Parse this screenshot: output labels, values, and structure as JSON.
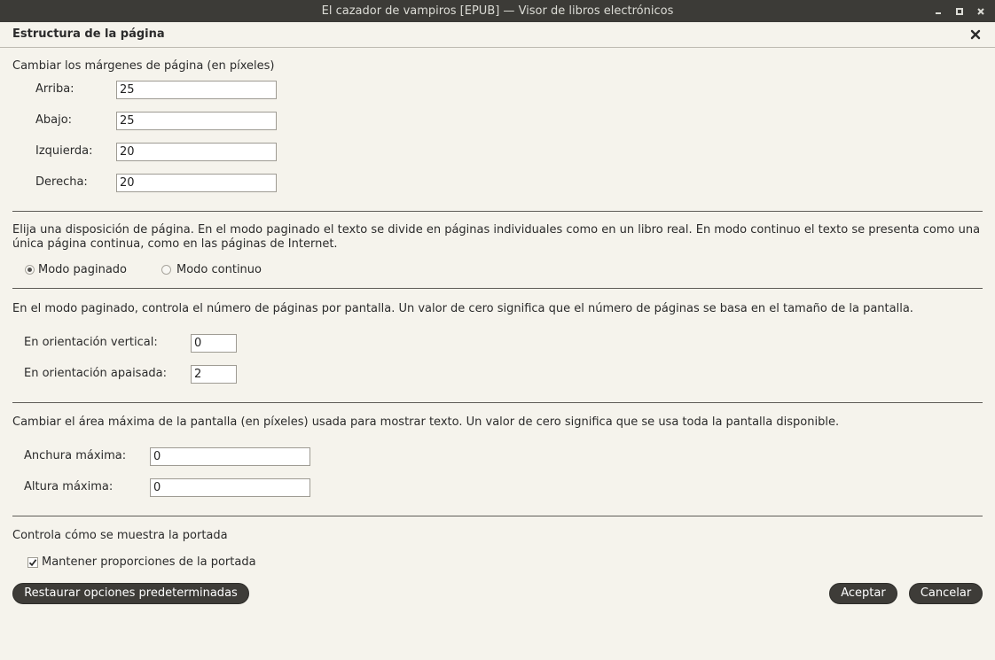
{
  "window": {
    "title": "El cazador de vampiros [EPUB] — Visor de libros electrónicos"
  },
  "dialog": {
    "heading": "Estructura de la página"
  },
  "margins": {
    "label": "Cambiar los márgenes de página (en píxeles)",
    "top_label": "Arriba:",
    "top_value": "25",
    "bottom_label": "Abajo:",
    "bottom_value": "25",
    "left_label": "Izquierda:",
    "left_value": "20",
    "right_label": "Derecha:",
    "right_value": "20"
  },
  "layout": {
    "description": "Elija una disposición de página. En el modo paginado el texto se divide en páginas individuales como en un libro real. En modo continuo el texto se presenta como una única página continua, como en las páginas de Internet.",
    "paged_label": "Modo paginado",
    "continuous_label": "Modo continuo",
    "selected": "Modo paginado"
  },
  "pages_per_screen": {
    "description": "En el modo paginado, controla el número de páginas por pantalla. Un valor de cero significa que el número de páginas se basa en el tamaño de la pantalla.",
    "portrait_label": "En orientación vertical:",
    "portrait_value": "0",
    "landscape_label": "En orientación apaisada:",
    "landscape_value": "2"
  },
  "max_area": {
    "description": "Cambiar el área máxima de la pantalla (en píxeles) usada para mostrar texto. Un valor de cero significa que se usa toda la pantalla disponible.",
    "width_label": "Anchura máxima:",
    "width_value": "0",
    "height_label": "Altura máxima:",
    "height_value": "0"
  },
  "cover": {
    "description": "Controla cómo se muestra la portada",
    "keep_aspect_label": "Mantener proporciones de la portada",
    "keep_aspect_checked": true
  },
  "buttons": {
    "restore_label": "Restaurar opciones predeterminadas",
    "ok_label": "Aceptar",
    "cancel_label": "Cancelar"
  }
}
